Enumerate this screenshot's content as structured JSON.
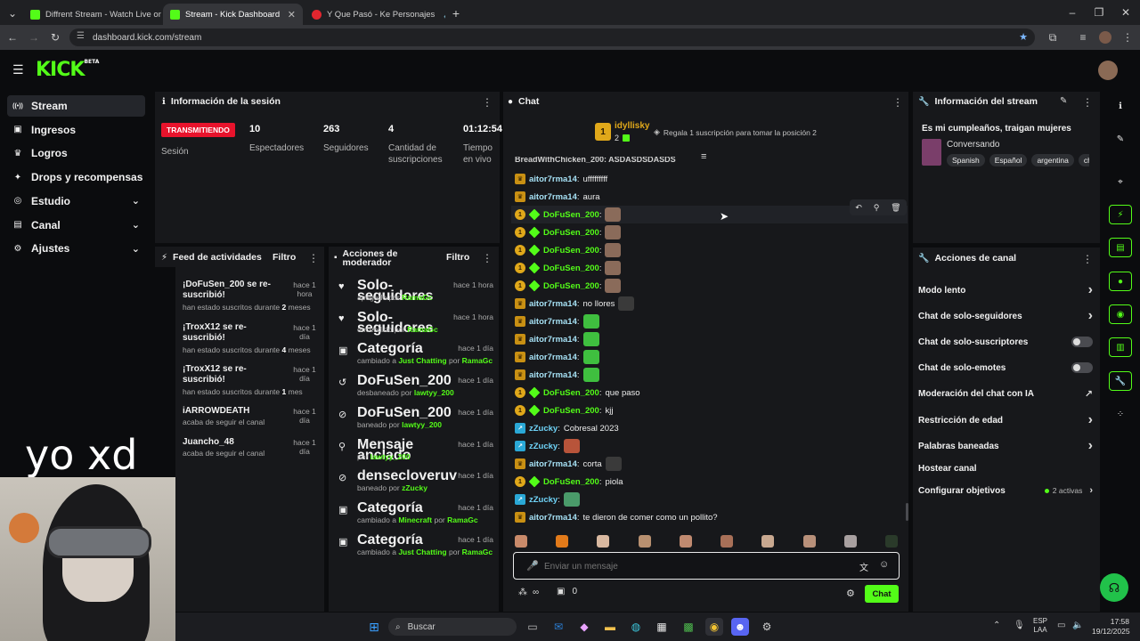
{
  "browser": {
    "tabs": [
      {
        "label": "Diffrent Stream - Watch Live on",
        "active": false,
        "color": "#53fc18"
      },
      {
        "label": "Stream - Kick Dashboard",
        "active": true,
        "color": "#53fc18"
      },
      {
        "label": "Y Que Pasó - Ke Personajes",
        "active": false,
        "color": "#e3262f"
      }
    ],
    "url": "dashboard.kick.com/stream"
  },
  "brand": {
    "logo": "KICK",
    "beta": "BETA",
    "accent": "#53fc18"
  },
  "sidebar": {
    "items": [
      {
        "label": "Stream",
        "icon": "broadcast-icon",
        "active": true,
        "chevron": false
      },
      {
        "label": "Ingresos",
        "icon": "money-icon",
        "active": false,
        "chevron": false
      },
      {
        "label": "Logros",
        "icon": "trophy-icon",
        "active": false,
        "chevron": false
      },
      {
        "label": "Drops y recompensas",
        "icon": "gift-icon",
        "active": false,
        "chevron": false
      },
      {
        "label": "Estudio",
        "icon": "studio-icon",
        "active": false,
        "chevron": true
      },
      {
        "label": "Canal",
        "icon": "channel-icon",
        "active": false,
        "chevron": true
      },
      {
        "label": "Ajustes",
        "icon": "gear-icon",
        "active": false,
        "chevron": true
      }
    ]
  },
  "session": {
    "title": "Información de la sesión",
    "status": "TRANSMITIENDO",
    "status_label": "Sesión",
    "stats": [
      {
        "value": "10",
        "label": "Espectadores"
      },
      {
        "value": "263",
        "label": "Seguidores"
      },
      {
        "value": "4",
        "label": "Cantidad de suscripciones"
      },
      {
        "value": "01:12:54",
        "label": "Tiempo en vivo"
      }
    ]
  },
  "activity": {
    "title": "Feed de actividades",
    "filter": "Filtro",
    "items": [
      {
        "icon": "sparkle-icon",
        "title": "¡DoFuSen_200 se re-suscribió!",
        "sub_pre": "han estado suscritos durante ",
        "sub_hl": "2",
        "sub_post": " meses",
        "time": "hace 1 hora"
      },
      {
        "icon": "sparkle-icon",
        "title": "¡TroxX12 se re-suscribió!",
        "sub_pre": "han estado suscritos durante ",
        "sub_hl": "4",
        "sub_post": " meses",
        "time": "hace 1 día"
      },
      {
        "icon": "sparkle-icon",
        "title": "¡TroxX12 se re-suscribió!",
        "sub_pre": "han estado suscritos durante ",
        "sub_hl": "1",
        "sub_post": " mes",
        "time": "hace 1 día"
      },
      {
        "icon": "heart-icon",
        "title": "iARROWDEATH",
        "sub_pre": "acaba de seguir el canal",
        "sub_hl": "",
        "sub_post": "",
        "time": "hace 1 día"
      },
      {
        "icon": "heart-icon",
        "title": "Juancho_48",
        "sub_pre": "acaba de seguir el canal",
        "sub_hl": "",
        "sub_post": "",
        "time": "hace 1 día"
      }
    ]
  },
  "mod": {
    "title": "Acciones de moderador",
    "filter": "Filtro",
    "items": [
      {
        "icon": "heart-icon",
        "title": "Solo-seguidores",
        "pre": "apagado por ",
        "hl": "RamaGc",
        "mid": "",
        "hl2": "",
        "time": "hace 1 hora"
      },
      {
        "icon": "heart-icon",
        "title": "Solo-seguidores",
        "pre": "encendido por ",
        "hl": "RamaGc",
        "mid": "",
        "hl2": "",
        "time": "hace 1 hora"
      },
      {
        "icon": "category-icon",
        "title": "Categoría",
        "pre": "cambiado a ",
        "hl": "Just Chatting",
        "mid": " por ",
        "hl2": "RamaGc",
        "time": "hace 1 día"
      },
      {
        "icon": "unban-icon",
        "title": "DoFuSen_200",
        "pre": "desbaneado por ",
        "hl": "lawtyy_200",
        "mid": "",
        "hl2": "",
        "time": "hace 1 día"
      },
      {
        "icon": "ban-icon",
        "title": "DoFuSen_200",
        "pre": "baneado por ",
        "hl": "lawtyy_200",
        "mid": "",
        "hl2": "",
        "time": "hace 1 día"
      },
      {
        "icon": "pin-icon",
        "title": "Mensaje anclado",
        "pre": "por ",
        "hl": "lawtyy_200",
        "mid": "",
        "hl2": "",
        "time": "hace 1 día"
      },
      {
        "icon": "ban-icon",
        "title": "densecloveruv",
        "pre": "baneado por ",
        "hl": "zZucky",
        "mid": "",
        "hl2": "",
        "time": "hace 1 día"
      },
      {
        "icon": "category-icon",
        "title": "Categoría",
        "pre": "cambiado a ",
        "hl": "Minecraft",
        "mid": " por ",
        "hl2": "RamaGc",
        "time": "hace 1 día"
      },
      {
        "icon": "category-icon",
        "title": "Categoría",
        "pre": "cambiado a ",
        "hl": "Just Chatting",
        "mid": " por ",
        "hl2": "RamaGc",
        "time": "hace 1 día"
      }
    ]
  },
  "chat": {
    "title": "Chat",
    "top_user": "idyllisky",
    "top_count": "2",
    "gift_text": "Regala 1 suscripción para tomar la posición 2",
    "cut_line": "BreadWithChicken_200: ASDASDSDASDS",
    "messages": [
      {
        "badge": "crown",
        "user": "aitor7rma14",
        "color": "#a6e1f5",
        "text": "ufffffffff",
        "emote": ""
      },
      {
        "badge": "crown",
        "user": "aitor7rma14",
        "color": "#a6e1f5",
        "text": "aura",
        "emote": ""
      },
      {
        "badge": "sub",
        "user": "DoFuSen_200",
        "color": "#53fc18",
        "text": "",
        "emote": "#8a6b5a"
      },
      {
        "badge": "sub",
        "user": "DoFuSen_200",
        "color": "#53fc18",
        "text": "",
        "emote": "#8a6b5a"
      },
      {
        "badge": "sub",
        "user": "DoFuSen_200",
        "color": "#53fc18",
        "text": "",
        "emote": "#8a6b5a"
      },
      {
        "badge": "sub",
        "user": "DoFuSen_200",
        "color": "#53fc18",
        "text": "",
        "emote": "#8a6b5a"
      },
      {
        "badge": "sub",
        "user": "DoFuSen_200",
        "color": "#53fc18",
        "text": "",
        "emote": "#8a6b5a"
      },
      {
        "badge": "crown",
        "user": "aitor7rma14",
        "color": "#a6e1f5",
        "text": "no llores",
        "emote": "#3a3a3a"
      },
      {
        "badge": "crown",
        "user": "aitor7rma14",
        "color": "#a6e1f5",
        "text": "",
        "emote": "#3fbf3f"
      },
      {
        "badge": "crown",
        "user": "aitor7rma14",
        "color": "#a6e1f5",
        "text": "",
        "emote": "#3fbf3f"
      },
      {
        "badge": "crown",
        "user": "aitor7rma14",
        "color": "#a6e1f5",
        "text": "",
        "emote": "#3fbf3f"
      },
      {
        "badge": "crown",
        "user": "aitor7rma14",
        "color": "#a6e1f5",
        "text": "",
        "emote": "#3fbf3f"
      },
      {
        "badge": "sub",
        "user": "DoFuSen_200",
        "color": "#53fc18",
        "text": "que paso",
        "emote": ""
      },
      {
        "badge": "sub",
        "user": "DoFuSen_200",
        "color": "#53fc18",
        "text": "kjj",
        "emote": ""
      },
      {
        "badge": "z",
        "user": "zZucky",
        "color": "#6fd3f7",
        "text": "Cobresal 2023",
        "emote": ""
      },
      {
        "badge": "z",
        "user": "zZucky",
        "color": "#6fd3f7",
        "text": "",
        "emote": "#b8543a"
      },
      {
        "badge": "crown",
        "user": "aitor7rma14",
        "color": "#a6e1f5",
        "text": "corta",
        "emote": "#3a3a3a"
      },
      {
        "badge": "sub",
        "user": "DoFuSen_200",
        "color": "#53fc18",
        "text": "piola",
        "emote": ""
      },
      {
        "badge": "z",
        "user": "zZucky",
        "color": "#6fd3f7",
        "text": "",
        "emote": "#4a9b6a"
      },
      {
        "badge": "crown",
        "user": "aitor7rma14",
        "color": "#a6e1f5",
        "text": "te dieron de comer como un pollito?",
        "emote": ""
      }
    ],
    "input_placeholder": "Enviar un mensaje",
    "send_label": "Chat",
    "count": "0"
  },
  "stream_info": {
    "title": "Información del stream",
    "stream_title": "Es mi cumpleaños, traigan mujeres",
    "category": "Conversando",
    "tags": [
      "Spanish",
      "Español",
      "argentina",
      "ch"
    ]
  },
  "channel_actions": {
    "title": "Acciones de canal",
    "items": [
      {
        "label": "Modo lento",
        "control": "chevron"
      },
      {
        "label": "Chat de solo-seguidores",
        "control": "chevron"
      },
      {
        "label": "Chat de solo-suscriptores",
        "control": "toggle",
        "on": false
      },
      {
        "label": "Chat de solo-emotes",
        "control": "toggle",
        "on": false
      },
      {
        "label": "Moderación del chat con IA",
        "control": "external"
      },
      {
        "label": "Restricción de edad",
        "control": "chevron"
      },
      {
        "label": "Palabras baneadas",
        "control": "chevron"
      },
      {
        "label": "Hostear canal",
        "control": "none"
      },
      {
        "label": "Configurar objetivos",
        "control": "chevron",
        "extra": "2 activas"
      }
    ]
  },
  "overlay_text": "yo xd",
  "taskbar": {
    "search": "Buscar",
    "lang1": "ESP",
    "lang2": "LAA",
    "time": "17:58",
    "date": "19/12/2025"
  }
}
